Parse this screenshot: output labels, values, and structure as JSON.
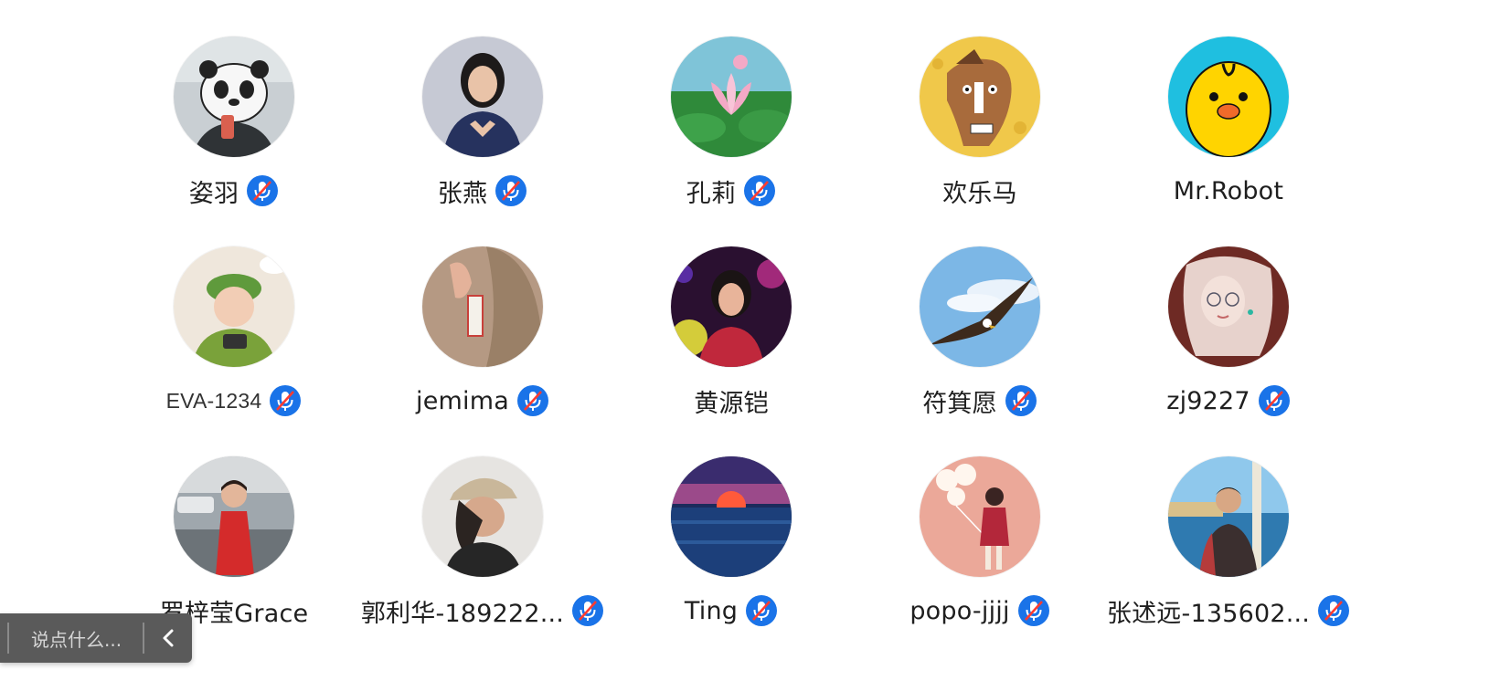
{
  "participants": [
    {
      "name": "姿羽",
      "verified": true,
      "avatar": "panda"
    },
    {
      "name": "张燕",
      "verified": true,
      "avatar": "woman-portrait"
    },
    {
      "name": "孔莉",
      "verified": true,
      "avatar": "lotus"
    },
    {
      "name": "欢乐马",
      "verified": false,
      "avatar": "cartoon-horse"
    },
    {
      "name": "Mr.Robot",
      "verified": false,
      "avatar": "yellow-chick"
    },
    {
      "name": "EVA-1234",
      "verified": true,
      "avatar": "baby-green-hat"
    },
    {
      "name": "jemima",
      "verified": true,
      "avatar": "earring-closeup"
    },
    {
      "name": "黄源铠",
      "verified": false,
      "avatar": "girl-night-lights"
    },
    {
      "name": "符箕愿",
      "verified": true,
      "avatar": "eagle-sky"
    },
    {
      "name": "zj9227",
      "verified": true,
      "avatar": "anime-girl"
    },
    {
      "name": "罗梓莹Grace",
      "verified": false,
      "avatar": "child-red-dress"
    },
    {
      "name": "郭利华-189222...",
      "verified": true,
      "avatar": "woman-cap"
    },
    {
      "name": "Ting",
      "verified": true,
      "avatar": "sunset-sea"
    },
    {
      "name": "popo-jjjj",
      "verified": true,
      "avatar": "girl-balloons-2022"
    },
    {
      "name": "张述远-135602...",
      "verified": true,
      "avatar": "man-beach"
    }
  ],
  "chat": {
    "placeholder": "说点什么...",
    "collapse_icon": "chevron-left-icon"
  },
  "colors": {
    "verified_badge": "#1a73e8",
    "chat_bar": "#5a5a5a"
  }
}
